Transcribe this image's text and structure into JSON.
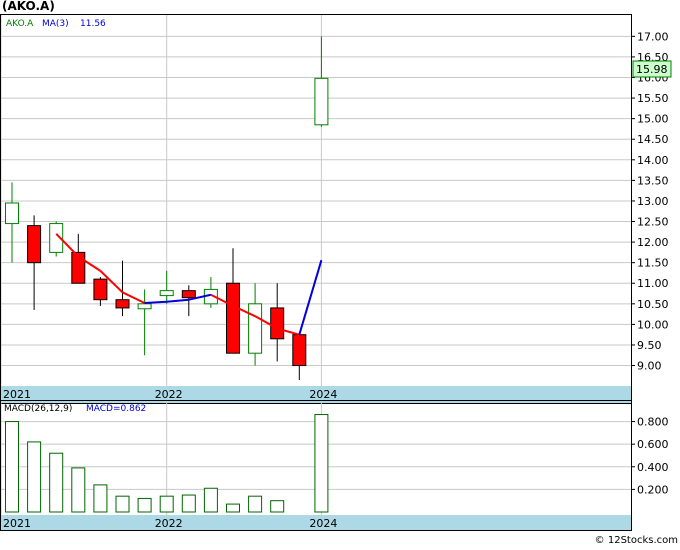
{
  "title": "(AKO.A)",
  "legend": {
    "ticker": "AKO.A",
    "ma_label": "MA(3)",
    "ma_value": "11.56"
  },
  "last_price_label": "15.98",
  "macd_legend": {
    "label": "MACD(26,12,9)",
    "value_label": "MACD=0.862"
  },
  "watermark": "© 12Stocks.com",
  "colors": {
    "up_candle_fill": "#ffffff",
    "up_candle_stroke": "#008000",
    "down_candle": "#ff0000",
    "ma_down": "#ff0000",
    "ma_up": "#0000dd",
    "macd_bar": "#006400",
    "axis_band": "#add8e6",
    "grid": "#c8c8c8",
    "price_label_bg": "#ccffcc"
  },
  "chart_data": [
    {
      "type": "candlestick",
      "series_names": [
        "AKO.A",
        "MA(3)"
      ],
      "x_ticks": [
        "2021",
        "2022",
        "2024"
      ],
      "y_ticks": [
        "9.00",
        "9.50",
        "10.00",
        "10.50",
        "11.00",
        "11.50",
        "12.00",
        "12.50",
        "13.00",
        "13.50",
        "14.00",
        "14.50",
        "15.00",
        "15.50",
        "16.00",
        "16.50",
        "17.00"
      ],
      "ylim": [
        8.6,
        17.3
      ],
      "candles": [
        {
          "open": 12.45,
          "high": 13.45,
          "low": 11.5,
          "close": 12.95
        },
        {
          "open": 12.4,
          "high": 12.65,
          "low": 10.35,
          "close": 11.5
        },
        {
          "open": 11.75,
          "high": 12.5,
          "low": 11.65,
          "close": 12.45
        },
        {
          "open": 11.75,
          "high": 12.2,
          "low": 11.0,
          "close": 11.0
        },
        {
          "open": 11.1,
          "high": 11.15,
          "low": 10.45,
          "close": 10.6
        },
        {
          "open": 10.6,
          "high": 11.55,
          "low": 10.2,
          "close": 10.4
        },
        {
          "open": 10.38,
          "high": 10.85,
          "low": 9.25,
          "close": 10.5
        },
        {
          "open": 10.7,
          "high": 11.3,
          "low": 10.5,
          "close": 10.82
        },
        {
          "open": 10.82,
          "high": 10.95,
          "low": 10.2,
          "close": 10.65
        },
        {
          "open": 10.5,
          "high": 11.15,
          "low": 10.4,
          "close": 10.85
        },
        {
          "open": 11.0,
          "high": 11.85,
          "low": 9.35,
          "close": 9.3
        },
        {
          "open": 9.3,
          "high": 11.0,
          "low": 9.0,
          "close": 10.5
        },
        {
          "open": 10.4,
          "high": 11.0,
          "low": 9.1,
          "close": 9.65
        },
        {
          "open": 9.75,
          "high": 9.75,
          "low": 8.65,
          "close": 9.0
        },
        {
          "open": 14.85,
          "high": 17.0,
          "low": 14.8,
          "close": 15.98
        }
      ],
      "ma": [
        null,
        null,
        12.2,
        11.65,
        11.3,
        10.78,
        10.52,
        10.55,
        10.6,
        10.72,
        10.45,
        10.2,
        9.9,
        9.75,
        11.56
      ]
    },
    {
      "type": "bar",
      "series_names": [
        "MACD(26,12,9)"
      ],
      "x_ticks": [
        "2021",
        "2022",
        "2024"
      ],
      "y_ticks": [
        "0.200",
        "0.400",
        "0.600",
        "0.800"
      ],
      "ylim": [
        0,
        0.92
      ],
      "values": [
        0.8,
        0.62,
        0.52,
        0.39,
        0.24,
        0.14,
        0.12,
        0.14,
        0.15,
        0.21,
        0.07,
        0.14,
        0.1,
        0.0,
        0.862
      ]
    }
  ]
}
